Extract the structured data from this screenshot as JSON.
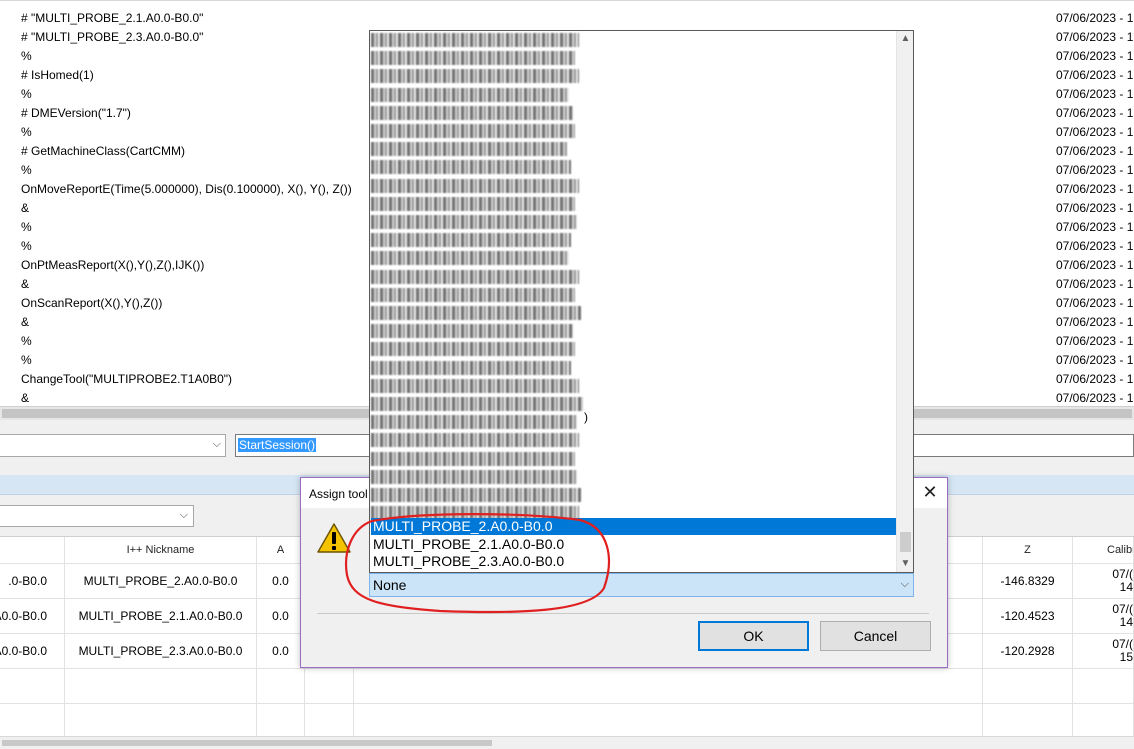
{
  "log": {
    "rows": [
      {
        "cmd": "# \"MULTI_PROBE_2.1.A0.0-B0.0\"",
        "time": "07/06/2023 - 1"
      },
      {
        "cmd": "# \"MULTI_PROBE_2.3.A0.0-B0.0\"",
        "time": "07/06/2023 - 1"
      },
      {
        "cmd": "%",
        "time": "07/06/2023 - 1"
      },
      {
        "cmd": "# IsHomed(1)",
        "time": "07/06/2023 - 1"
      },
      {
        "cmd": "%",
        "time": "07/06/2023 - 1"
      },
      {
        "cmd": "# DMEVersion(\"1.7\")",
        "time": "07/06/2023 - 1"
      },
      {
        "cmd": "%",
        "time": "07/06/2023 - 1"
      },
      {
        "cmd": "# GetMachineClass(CartCMM)",
        "time": "07/06/2023 - 1"
      },
      {
        "cmd": "%",
        "time": "07/06/2023 - 1"
      },
      {
        "cmd": "OnMoveReportE(Time(5.000000), Dis(0.100000), X(), Y(), Z())",
        "time": "07/06/2023 - 1"
      },
      {
        "cmd": "&",
        "time": "07/06/2023 - 1"
      },
      {
        "cmd": "%",
        "time": "07/06/2023 - 1"
      },
      {
        "cmd": "%",
        "time": "07/06/2023 - 1"
      },
      {
        "cmd": "OnPtMeasReport(X(),Y(),Z(),IJK())",
        "time": "07/06/2023 - 1"
      },
      {
        "cmd": "&",
        "time": "07/06/2023 - 1"
      },
      {
        "cmd": "OnScanReport(X(),Y(),Z())",
        "time": "07/06/2023 - 1"
      },
      {
        "cmd": "&",
        "time": "07/06/2023 - 1"
      },
      {
        "cmd": "%",
        "time": "07/06/2023 - 1"
      },
      {
        "cmd": "%",
        "time": "07/06/2023 - 1"
      },
      {
        "cmd": "ChangeTool(\"MULTIPROBE2.T1A0B0\")",
        "time": "07/06/2023 - 1"
      },
      {
        "cmd": "&",
        "time": "07/06/2023 - 1"
      }
    ]
  },
  "command_bar": {
    "input_value": "StartSession()",
    "combo_arrow": "⌵"
  },
  "grid": {
    "headers": {
      "tool": "",
      "nickname": "I++ Nickname",
      "a": "A",
      "z": "Z",
      "calibrated": "Calibr"
    },
    "rows": [
      {
        "tool": ".0-B0.0",
        "nickname": "MULTI_PROBE_2.A0.0-B0.0",
        "a": "0.0",
        "z": "-146.8329",
        "cal1": "07/(",
        "cal2": "14"
      },
      {
        "tool": "A0.0-B0.0",
        "nickname": "MULTI_PROBE_2.1.A0.0-B0.0",
        "a": "0.0",
        "z": "-120.4523",
        "cal1": "07/(",
        "cal2": "14"
      },
      {
        "tool": "A0.0-B0.0",
        "nickname": "MULTI_PROBE_2.3.A0.0-B0.0",
        "a": "0.0",
        "z": "-120.2928",
        "cal1": "07/(",
        "cal2": "15"
      }
    ]
  },
  "dialog": {
    "title": "Assign tool",
    "close": "✕",
    "icon": "warning-icon",
    "ok_label": "OK",
    "cancel_label": "Cancel",
    "combo_value": "None",
    "list_partial_text": ")",
    "list_items": [
      {
        "label": "MULTI_PROBE_2.A0.0-B0.0",
        "selected": true
      },
      {
        "label": "MULTI_PROBE_2.1.A0.0-B0.0",
        "selected": false
      },
      {
        "label": "MULTI_PROBE_2.3.A0.0-B0.0",
        "selected": false
      }
    ]
  },
  "colors": {
    "selection": "#0078d7",
    "annotation": "#e02020",
    "warning": "#f5c400"
  }
}
